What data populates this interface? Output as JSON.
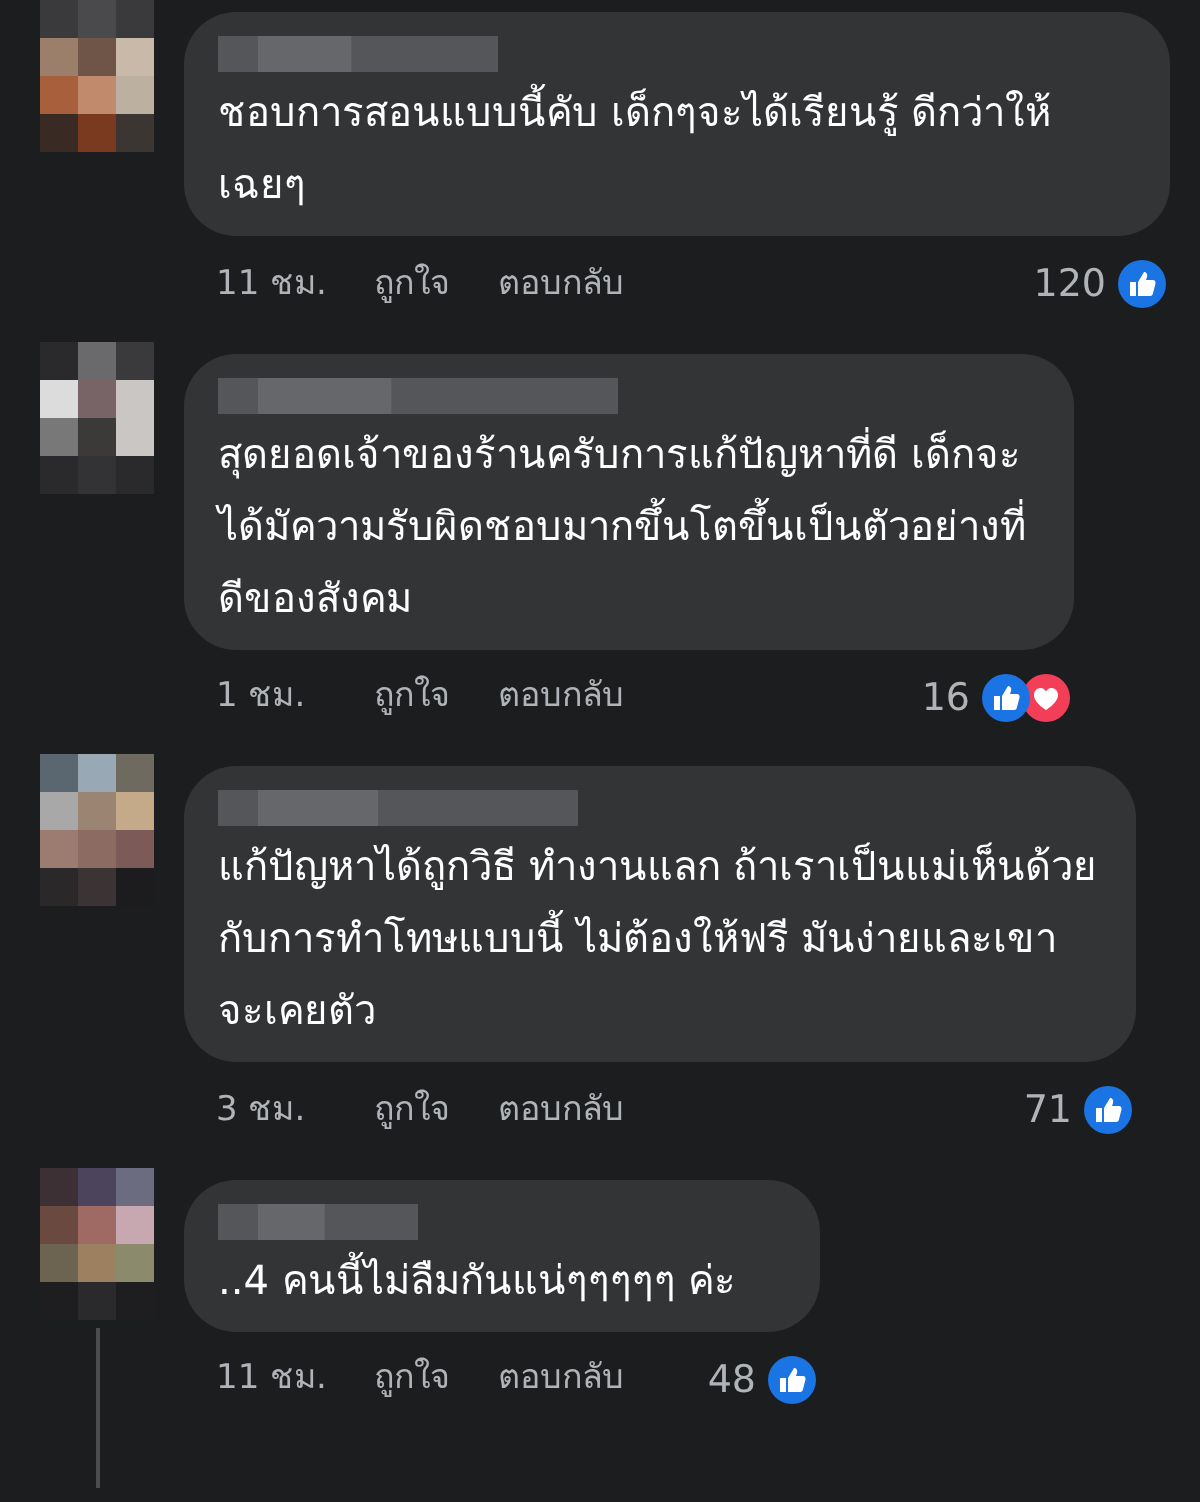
{
  "comments": [
    {
      "text": "ชอบการสอนแบบนี้คับ เด็กๆจะได้เรียนรู้ ดีกว่าให้เฉยๆ",
      "time": "11 ชม.",
      "like": "ถูกใจ",
      "reply": "ตอบกลับ",
      "count": "120",
      "reactions": [
        {
          "kind": "like"
        }
      ],
      "thread_line": false
    },
    {
      "text": "สุดยอดเจ้าของร้านครับการแก้ปัญหาที่ดี เด็กจะได้มัความรับผิดชอบมากขึ้นโตขึ้นเป็นตัวอย่างที่ดีของสังคม",
      "time": "1 ชม.",
      "like": "ถูกใจ",
      "reply": "ตอบกลับ",
      "count": "16",
      "reactions": [
        {
          "kind": "like"
        },
        {
          "kind": "love"
        }
      ],
      "thread_line": false
    },
    {
      "text": "แก้ปัญหาได้ถูกวิธี ทำงานแลก ถ้าเราเป็นแม่เห็นด้วยกับการทำโทษแบบนี้ ไม่ต้องให้ฟรี มันง่ายและเขาจะเคยตัว",
      "time": "3 ชม.",
      "like": "ถูกใจ",
      "reply": "ตอบกลับ",
      "count": "71",
      "reactions": [
        {
          "kind": "like"
        }
      ],
      "thread_line": false
    },
    {
      "text": "..4 คนนี้ไม่ลืมกันแน่ๆๆๆๆๆ ค่ะ",
      "time": "11 ชม.",
      "like": "ถูกใจ",
      "reply": "ตอบกลับ",
      "count": "48",
      "reactions": [
        {
          "kind": "like"
        }
      ],
      "thread_line": true
    }
  ]
}
